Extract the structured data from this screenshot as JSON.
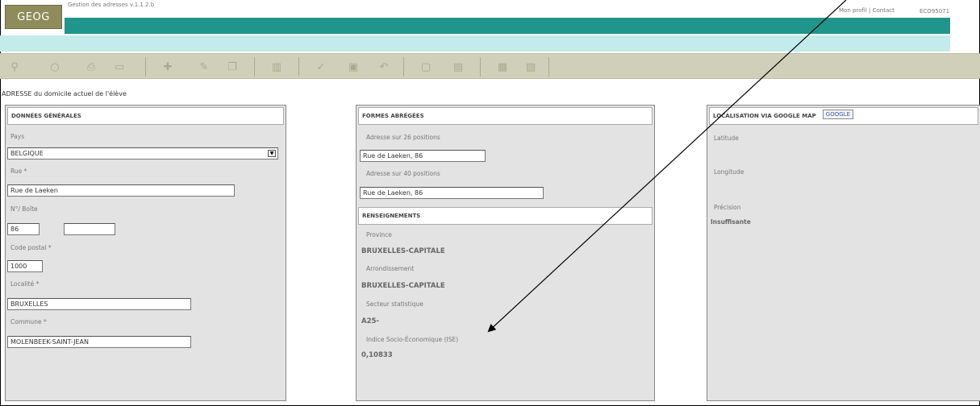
{
  "header": {
    "logo": "GEOG",
    "app_title": "Gestion des adresses v.1.1.2.b",
    "link_profile": "Mon profil",
    "link_sep": "|",
    "link_contact": "Contact",
    "user_code": "ECO95071"
  },
  "toolbar": {
    "icons": [
      "binoculars-icon",
      "magnifier-icon",
      "print-icon",
      "copy-icon",
      "add-icon",
      "edit-icon",
      "duplicate-icon",
      "delete-icon",
      "check-icon",
      "save-icon",
      "undo-icon",
      "new-document-icon",
      "printer-icon",
      "calendar-icon",
      "export-icon"
    ]
  },
  "page_title": "ADRESSE du domicile actuel de l'élève",
  "general": {
    "heading": "DONNÉES GÉNÉRALES",
    "country_label": "Pays",
    "country_value": "BELGIQUE",
    "street_label": "Rue *",
    "street_value": "Rue de Laeken",
    "number_label": "N°/ Boîte",
    "number_value": "86",
    "box_value": "",
    "postcode_label": "Code postal *",
    "postcode_value": "1000",
    "locality_label": "Localité *",
    "locality_value": "BRUXELLES",
    "commune_label": "Commune *",
    "commune_value": "MOLENBEEK-SAINT-JEAN"
  },
  "short_forms": {
    "heading": "FORMES ABRÉGÉES",
    "addr26_label": "Adresse sur 26 positions",
    "addr26_value": "Rue de Laeken, 86",
    "addr40_label": "Adresse sur 40 positions",
    "addr40_value": "Rue de Laeken, 86"
  },
  "info": {
    "heading": "RENSEIGNEMENTS",
    "province_label": "Province",
    "province_value": "BRUXELLES-CAPITALE",
    "district_label": "Arrondissement",
    "district_value": "BRUXELLES-CAPITALE",
    "sector_label": "Secteur statistique",
    "sector_value": "A25-",
    "ise_label": "Indice Socio-Économique (ISE)",
    "ise_value": "0,10833"
  },
  "geo": {
    "heading": "LOCALISATION VIA GOOGLE MAP",
    "google_button": "Google",
    "latitude_label": "Latitude",
    "latitude_value": "",
    "longitude_label": "Longitude",
    "longitude_value": "",
    "precision_label": "Précision",
    "precision_value": "Insuffisante"
  },
  "colors": {
    "teal": "#20958c",
    "light_teal": "#c2ebe9",
    "logo": "#8e8c5a",
    "toolbar": "#d0d0ba"
  }
}
